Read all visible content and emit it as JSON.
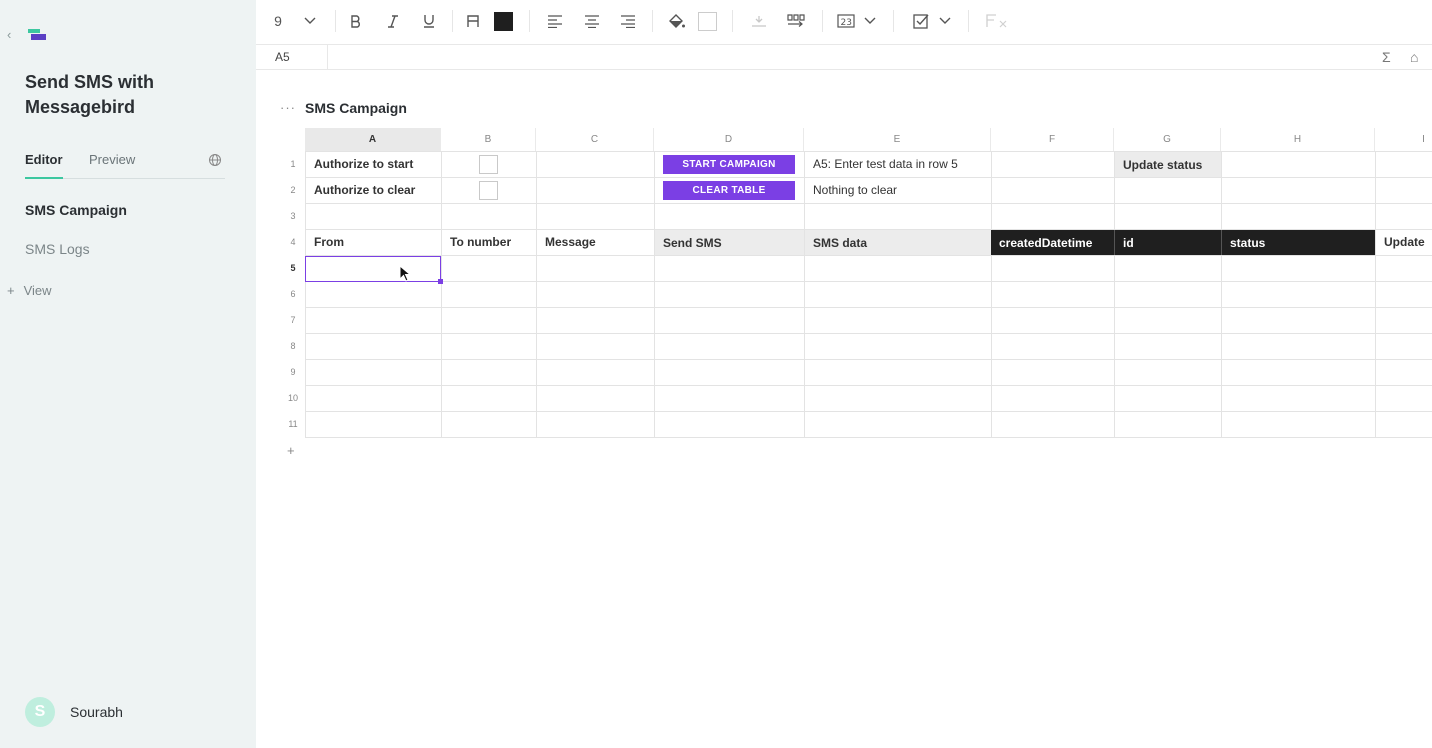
{
  "sidebar": {
    "back_glyph": "‹",
    "title": "Send SMS with Messagebird",
    "tabs": [
      {
        "label": "Editor",
        "active": true
      },
      {
        "label": "Preview",
        "active": false
      }
    ],
    "items": [
      {
        "label": "SMS Campaign",
        "active": true
      },
      {
        "label": "SMS Logs",
        "active": false
      }
    ],
    "add_view_label": "View",
    "add_view_glyph": "+",
    "user": {
      "initial": "S",
      "name": "Sourabh"
    }
  },
  "toolbar": {
    "font_size": "9",
    "fill_color": "#1f1f1f",
    "icons": [
      "chevron-down-icon",
      "bold-icon",
      "italic-icon",
      "underline-icon",
      "text-color-icon",
      "align-left-icon",
      "align-center-icon",
      "align-right-icon",
      "fill-color-icon",
      "column-width-icon",
      "wrap-text-icon",
      "number-format-icon",
      "checkbox-format-icon",
      "clear-format-icon",
      "sum-icon",
      "pin-icon"
    ]
  },
  "formula_bar": {
    "cell_ref": "A5",
    "sum_glyph": "Σ",
    "pin_glyph": "⌂"
  },
  "sheet": {
    "menu_glyph": "···",
    "title": "SMS Campaign",
    "columns": [
      "A",
      "B",
      "C",
      "D",
      "E",
      "F",
      "G",
      "H",
      "I"
    ],
    "selected_column": "A",
    "rows": [
      "1",
      "2",
      "3",
      "4",
      "5",
      "6",
      "7",
      "8",
      "9",
      "10",
      "11"
    ],
    "selected_row": "5",
    "add_row_glyph": "+",
    "row1": {
      "a": "Authorize to start",
      "button": "START CAMPAIGN",
      "e": "A5: Enter test data in row 5",
      "g": "Update status"
    },
    "row2": {
      "a": "Authorize to clear",
      "button": "CLEAR TABLE",
      "e": "Nothing to clear"
    },
    "row4": {
      "a": "From",
      "b": "To number",
      "c": "Message",
      "d": "Send SMS",
      "e": "SMS data",
      "f": "createdDatetime",
      "g": "id",
      "h": "status",
      "i": "Update"
    }
  },
  "colors": {
    "accent": "#7b3fe4",
    "brand_green": "#3cc7a0",
    "sidebar_bg": "#eef3f3"
  }
}
